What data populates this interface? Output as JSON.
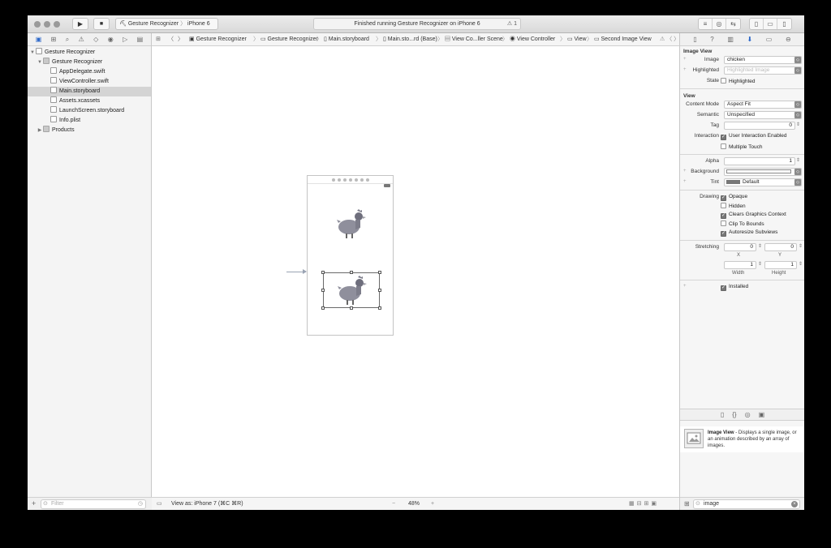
{
  "toolbar": {
    "scheme": "Gesture Recognizer",
    "device": "iPhone 6",
    "status": "Finished running Gesture Recognizer on iPhone 6",
    "warning_count": "1"
  },
  "navigator": {
    "tree": [
      {
        "label": "Gesture Recognizer",
        "indent": 0,
        "disc": "▼",
        "kind": "project",
        "selected": false
      },
      {
        "label": "Gesture Recognizer",
        "indent": 1,
        "disc": "▼",
        "kind": "folder",
        "selected": false
      },
      {
        "label": "AppDelegate.swift",
        "indent": 2,
        "disc": "",
        "kind": "file",
        "selected": false
      },
      {
        "label": "ViewController.swift",
        "indent": 2,
        "disc": "",
        "kind": "file",
        "selected": false
      },
      {
        "label": "Main.storyboard",
        "indent": 2,
        "disc": "",
        "kind": "file",
        "selected": true
      },
      {
        "label": "Assets.xcassets",
        "indent": 2,
        "disc": "",
        "kind": "file",
        "selected": false
      },
      {
        "label": "LaunchScreen.storyboard",
        "indent": 2,
        "disc": "",
        "kind": "file",
        "selected": false
      },
      {
        "label": "Info.plist",
        "indent": 2,
        "disc": "",
        "kind": "file",
        "selected": false
      },
      {
        "label": "Products",
        "indent": 1,
        "disc": "▶",
        "kind": "folder",
        "selected": false
      }
    ],
    "filter_placeholder": "Filter"
  },
  "jumpbar": [
    "Gesture Recognizer",
    "Gesture Recognizer",
    "Main.storyboard",
    "Main.sto...rd (Base)",
    "View Co...ller Scene",
    "View Controller",
    "View",
    "Second Image View"
  ],
  "canvas": {
    "view_as": "View as: iPhone 7 (⌘C ⌘R)",
    "zoom": "48%",
    "zoom_minus": "−",
    "zoom_plus": "+"
  },
  "inspector": {
    "image_view_section": "Image View",
    "image_label": "Image",
    "image_value": "chicken",
    "highlighted_label": "Highlighted",
    "highlighted_placeholder": "Highlighted Image",
    "state_label": "State",
    "state_check": "Highlighted",
    "view_section": "View",
    "content_mode_label": "Content Mode",
    "content_mode_value": "Aspect Fit",
    "semantic_label": "Semantic",
    "semantic_value": "Unspecified",
    "tag_label": "Tag",
    "tag_value": "0",
    "interaction_label": "Interaction",
    "user_interaction": "User Interaction Enabled",
    "multiple_touch": "Multiple Touch",
    "alpha_label": "Alpha",
    "alpha_value": "1",
    "background_label": "Background",
    "tint_label": "Tint",
    "tint_value": "Default",
    "drawing_label": "Drawing",
    "opaque": "Opaque",
    "hidden": "Hidden",
    "clears_context": "Clears Graphics Context",
    "clip_bounds": "Clip To Bounds",
    "autoresize": "Autoresize Subviews",
    "stretching_label": "Stretching",
    "stretch_x": "0",
    "stretch_y": "0",
    "stretch_w": "1",
    "stretch_h": "1",
    "x_label": "X",
    "y_label": "Y",
    "width_label": "Width",
    "height_label": "Height",
    "installed": "Installed"
  },
  "library": {
    "item_title": "Image View",
    "item_desc": " - Displays a single image, or an animation described by an array of images.",
    "filter_value": "image"
  }
}
